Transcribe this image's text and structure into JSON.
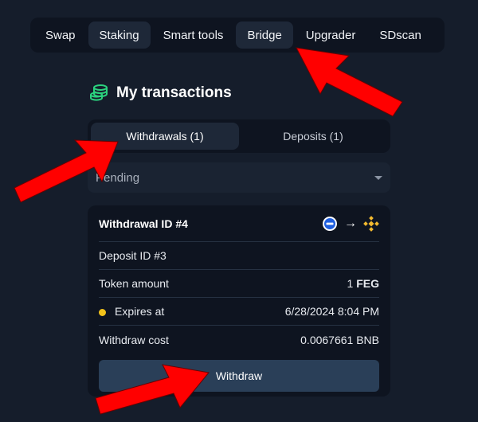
{
  "nav": {
    "items": [
      {
        "label": "Swap"
      },
      {
        "label": "Staking"
      },
      {
        "label": "Smart tools"
      },
      {
        "label": "Bridge"
      },
      {
        "label": "Upgrader"
      },
      {
        "label": "SDscan"
      }
    ]
  },
  "section": {
    "title": "My transactions",
    "icon": "coins-stack-icon",
    "accent_color": "#2bd27e"
  },
  "tabs": [
    {
      "label": "Withdrawals (1)",
      "active": true
    },
    {
      "label": "Deposits (1)",
      "active": false
    }
  ],
  "filter": {
    "selected": "Pending"
  },
  "card": {
    "title": "Withdrawal ID #4",
    "from_chain_icon": "circle-minus-icon",
    "to_chain_icon": "bnb-icon",
    "arrow": "→",
    "deposit_id": "Deposit ID #3",
    "token_amount_label": "Token amount",
    "token_amount_value": "1",
    "token_symbol": "FEG",
    "expires_label": "Expires at",
    "expires_value": "6/28/2024 8:04 PM",
    "expires_status_color": "#f2c21a",
    "cost_label": "Withdraw cost",
    "cost_value": "0.0067661 BNB",
    "button_label": "Withdraw"
  },
  "annotations": {
    "arrow_color": "#ff0000"
  }
}
